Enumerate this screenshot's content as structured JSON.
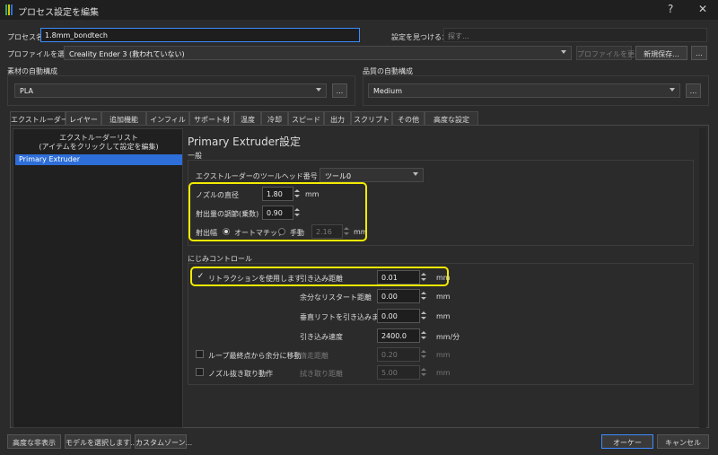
{
  "window": {
    "title": "プロセス設定を編集",
    "help": "?",
    "close": "✕"
  },
  "process": {
    "name_label": "プロセス名",
    "name_value": "1.8mm_bondtech",
    "find_label": "設定を見つける：",
    "find_placeholder": "探す..."
  },
  "profile": {
    "select_label": "プロファイルを選択",
    "selected": "Creality Ender 3 (救われていない)",
    "update_btn": "プロファイルを更新",
    "save_new_btn": "新規保存...",
    "more_btn": "..."
  },
  "material": {
    "label": "素材の自動構成",
    "selected": "PLA",
    "more_btn": "..."
  },
  "quality": {
    "label": "品質の自動構成",
    "selected": "Medium",
    "more_btn": "..."
  },
  "tabs": [
    "エクストルーダー",
    "レイヤー",
    "追加機能",
    "インフィル",
    "サポート材",
    "温度",
    "冷却",
    "スピード",
    "出力",
    "スクリプト",
    "その他",
    "高度な設定"
  ],
  "extruder_list": {
    "header_line1": "エクストルーダーリスト",
    "header_line2": "(アイテムをクリックして設定を編集)",
    "items": [
      "Primary Extruder"
    ]
  },
  "settings": {
    "title": "Primary Extruder設定",
    "general": {
      "section_label": "一般",
      "toolhead_label": "エクストルーダーのツールヘッド番号",
      "toolhead_value": "ツール0",
      "nozzle_label": "ノズルの直径",
      "nozzle_value": "1.80",
      "nozzle_unit": "mm",
      "multiplier_label": "射出量の調節(乗数)",
      "multiplier_value": "0.90",
      "width_label": "射出幅",
      "width_auto": "オートマチック",
      "width_manual": "手動",
      "width_value": "2.16",
      "width_unit": "mm"
    },
    "ooze": {
      "section_label": "にじみコントロール",
      "retraction_label": "リトラクションを使用します",
      "retraction_checked": "✓",
      "retract_dist_label": "引き込み距離",
      "retract_dist_value": "0.01",
      "retract_dist_unit": "mm",
      "extra_restart_label": "余分なリスタート距離",
      "extra_restart_value": "0.00",
      "extra_restart_unit": "mm",
      "vertical_lift_label": "垂直リフトを引き込みます",
      "vertical_lift_value": "0.00",
      "vertical_lift_unit": "mm",
      "retract_speed_label": "引き込み速度",
      "retract_speed_value": "2400.0",
      "retract_speed_unit": "mm/分",
      "coast_label": "ループ最終点から余分に移動",
      "coast_dist_label": "惰走距離",
      "coast_dist_value": "0.20",
      "coast_dist_unit": "mm",
      "wipe_label": "ノズル抜き取り動作",
      "wipe_dist_label": "拭き取り距離",
      "wipe_dist_value": "5.00",
      "wipe_dist_unit": "mm"
    }
  },
  "footer": {
    "hide_advanced": "高度な非表示",
    "select_models": "モデルを選択します...",
    "custom_zones": "カスタムゾーン...",
    "ok": "オーケー",
    "cancel": "キャンセル"
  },
  "colors": {
    "highlight": "#f2ea00",
    "selection": "#2d6ed8",
    "focus": "#3d8bff"
  }
}
